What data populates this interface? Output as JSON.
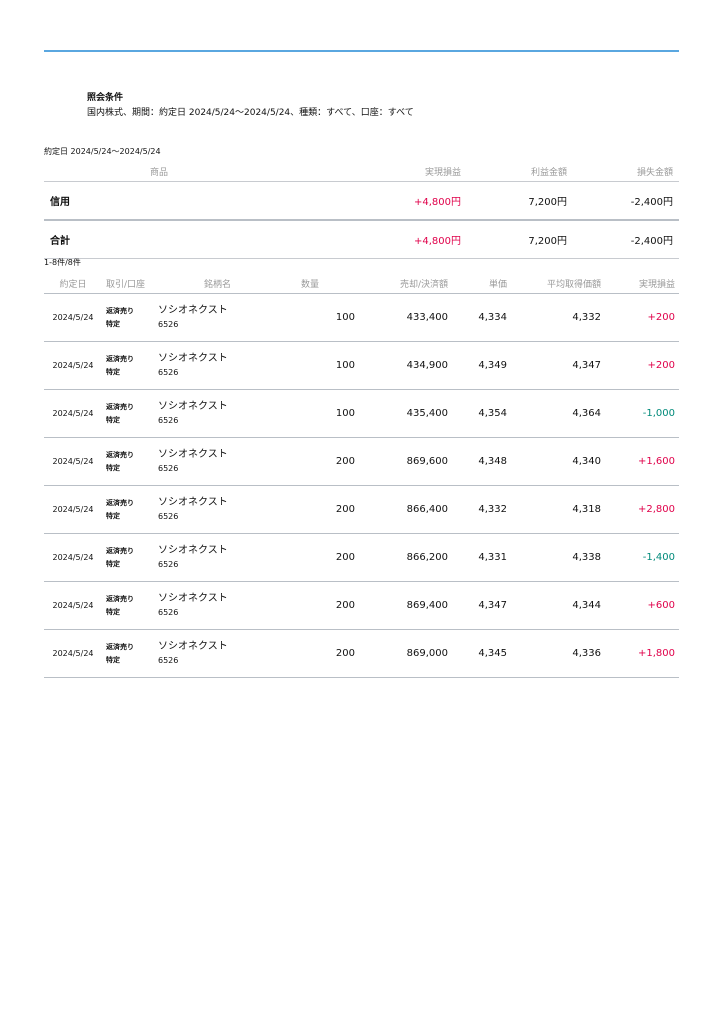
{
  "condition": {
    "title": "照会条件",
    "text": "国内株式、期間：約定日 2024/5/24〜2024/5/24、種類：すべて、口座：すべて"
  },
  "period_label": "約定日 2024/5/24〜2024/5/24",
  "summary": {
    "headers": [
      "商品",
      "実現損益",
      "利益金額",
      "損失金額"
    ],
    "rows": [
      {
        "label": "信用",
        "realized": "+4,800円",
        "profit": "7,200円",
        "loss": "-2,400円"
      },
      {
        "label": "合計",
        "realized": "+4,800円",
        "profit": "7,200円",
        "loss": "-2,400円"
      }
    ]
  },
  "count_text": "1-8件/8件",
  "detail": {
    "headers": [
      "約定日",
      "取引/口座",
      "銘柄名",
      "数量",
      "売却/決済額",
      "単価",
      "平均取得価額",
      "実現損益"
    ],
    "rows": [
      {
        "date": "2024/5/24",
        "trade": "返済売り",
        "account": "特定",
        "name": "ソシオネクスト",
        "code": "6526",
        "qty": "100",
        "amount": "433,400",
        "price": "4,334",
        "avg": "4,332",
        "pl": "+200"
      },
      {
        "date": "2024/5/24",
        "trade": "返済売り",
        "account": "特定",
        "name": "ソシオネクスト",
        "code": "6526",
        "qty": "100",
        "amount": "434,900",
        "price": "4,349",
        "avg": "4,347",
        "pl": "+200"
      },
      {
        "date": "2024/5/24",
        "trade": "返済売り",
        "account": "特定",
        "name": "ソシオネクスト",
        "code": "6526",
        "qty": "100",
        "amount": "435,400",
        "price": "4,354",
        "avg": "4,364",
        "pl": "-1,000"
      },
      {
        "date": "2024/5/24",
        "trade": "返済売り",
        "account": "特定",
        "name": "ソシオネクスト",
        "code": "6526",
        "qty": "200",
        "amount": "869,600",
        "price": "4,348",
        "avg": "4,340",
        "pl": "+1,600"
      },
      {
        "date": "2024/5/24",
        "trade": "返済売り",
        "account": "特定",
        "name": "ソシオネクスト",
        "code": "6526",
        "qty": "200",
        "amount": "866,400",
        "price": "4,332",
        "avg": "4,318",
        "pl": "+2,800"
      },
      {
        "date": "2024/5/24",
        "trade": "返済売り",
        "account": "特定",
        "name": "ソシオネクスト",
        "code": "6526",
        "qty": "200",
        "amount": "866,200",
        "price": "4,331",
        "avg": "4,338",
        "pl": "-1,400"
      },
      {
        "date": "2024/5/24",
        "trade": "返済売り",
        "account": "特定",
        "name": "ソシオネクスト",
        "code": "6526",
        "qty": "200",
        "amount": "869,400",
        "price": "4,347",
        "avg": "4,344",
        "pl": "+600"
      },
      {
        "date": "2024/5/24",
        "trade": "返済売り",
        "account": "特定",
        "name": "ソシオネクスト",
        "code": "6526",
        "qty": "200",
        "amount": "869,000",
        "price": "4,345",
        "avg": "4,336",
        "pl": "+1,800"
      }
    ]
  },
  "colors": {
    "positive": "#e0004a",
    "negative": "#008a7a",
    "accent_line": "#5aa7e0"
  }
}
